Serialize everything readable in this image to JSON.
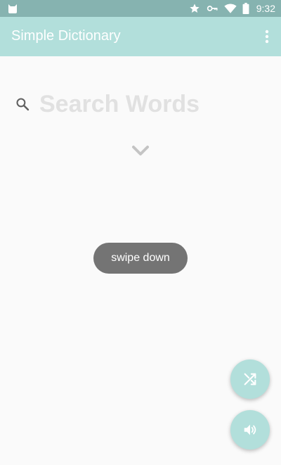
{
  "status_bar": {
    "time": "9:32",
    "icons": [
      "cat-notification-icon",
      "star-icon",
      "vpn-key-icon",
      "wifi-icon",
      "battery-icon"
    ]
  },
  "app_bar": {
    "title": "Simple Dictionary",
    "menu_icon": "more-vert-icon"
  },
  "search": {
    "placeholder": "Search Words",
    "value": "",
    "icon": "search-icon"
  },
  "hint": {
    "icon": "chevron-down-icon"
  },
  "toast": {
    "text": "swipe down"
  },
  "fabs": {
    "shuffle_icon": "shuffle-icon",
    "sound_icon": "volume-icon"
  },
  "colors": {
    "status_bar": "#86b3b0",
    "primary": "#b2dfdb",
    "background": "#fafafa",
    "toast": "#747474"
  }
}
